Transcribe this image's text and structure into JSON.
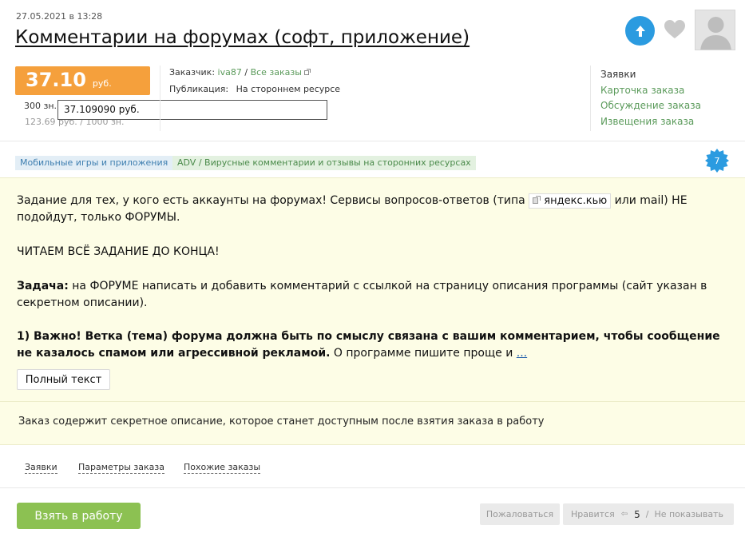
{
  "order": {
    "date": "27.05.2021 в 13:28",
    "title": "Комментарии на форумах (софт, приложение)"
  },
  "price": {
    "value": "37.10",
    "unit": "руб.",
    "line1": "300 зн.",
    "line2": "123.69 руб. / 1000 зн.",
    "tooltip": "37.109090 руб."
  },
  "client": {
    "label": "Заказчик:",
    "name": "iva87",
    "separator": "/",
    "all_orders": "Все заказы",
    "pub_label": "Публикация:",
    "pub_value": "На стороннем ресурсе"
  },
  "side_links": {
    "header": "Заявки",
    "items": [
      "Карточка заказа",
      "Обсуждение заказа",
      "Извещения заказа"
    ]
  },
  "tags": [
    "Мобильные игры и приложения",
    "ADV / Вирусные комментарии и отзывы на сторонних ресурсах"
  ],
  "badge": {
    "count": "7"
  },
  "description": {
    "p1_before": "Задание для тех, у кого есть аккаунты на форумах! Сервисы вопросов-ответов (типа",
    "p1_link": "яндекс.кью",
    "p1_after": "или mail) НЕ подойдут, только ФОРУМЫ.",
    "p2": "ЧИТАЕМ ВСЁ ЗАДАНИЕ ДО КОНЦА!",
    "p3_bold": "Задача:",
    "p3_rest": "на ФОРУМЕ написать и добавить комментарий с ссылкой на страницу описания программы (сайт указан в секретном описании).",
    "p4_bold": "1) Важно! Ветка (тема) форума должна быть по смыслу связана с вашим комментарием, чтобы сообщение не казалось спамом или агрессивной рекламой.",
    "p4_rest": "О программе пишите проще и",
    "more": "...",
    "full_text_button": "Полный текст",
    "secret_note": "Заказ содержит секретное описание, которое станет доступным после взятия заказа в работу"
  },
  "tabs": [
    "Заявки",
    "Параметры заказа",
    "Похожие заказы"
  ],
  "actions": {
    "take": "Взять в работу",
    "complain": "Пожаловаться",
    "like": "Нравится",
    "like_count": "5",
    "hide": "Не показывать"
  },
  "colors": {
    "price_bg": "#f5a03c",
    "take_btn": "#8cc152",
    "up_btn": "#2b9be0",
    "link_green": "#5a9a5a",
    "desc_bg": "#fdfde6"
  }
}
